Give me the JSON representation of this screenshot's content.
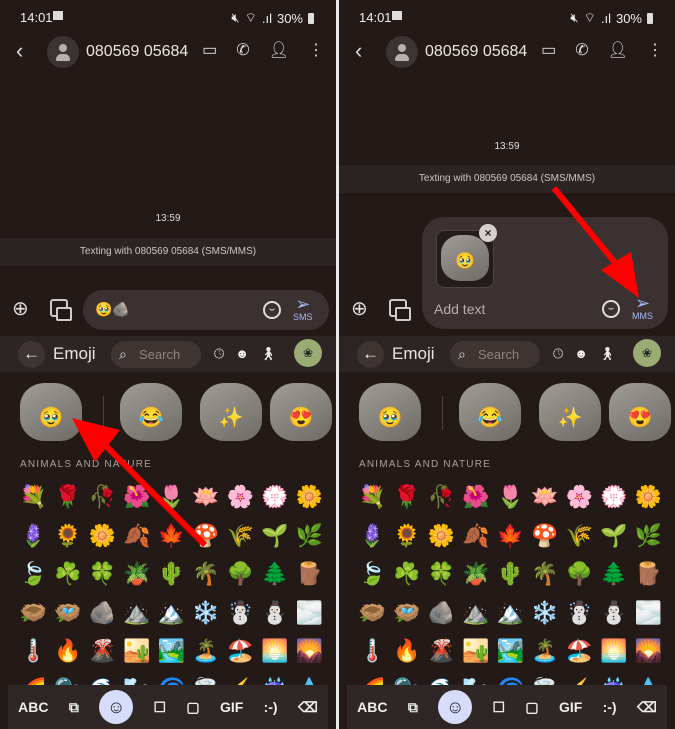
{
  "panels": [
    {
      "status": {
        "time": "14:01",
        "battery": "30%"
      },
      "header": {
        "contact": "080569 05684"
      },
      "conversation": {
        "timestamp": "13:59",
        "banner": "Texting with 080569 05684 (SMS/MMS)"
      },
      "compose": {
        "content_emojis": "🥹🪨",
        "send_label": "SMS"
      },
      "emoji_bar": {
        "title": "Emoji",
        "search_placeholder": "Search"
      },
      "section_label": "ANIMALS AND NATURE"
    },
    {
      "status": {
        "time": "14:01",
        "battery": "30%"
      },
      "header": {
        "contact": "080569 05684"
      },
      "conversation": {
        "timestamp": "13:59",
        "banner": "Texting with 080569 05684 (SMS/MMS)"
      },
      "compose": {
        "placeholder": "Add text",
        "send_label": "MMS"
      },
      "emoji_bar": {
        "title": "Emoji",
        "search_placeholder": "Search"
      },
      "section_label": "ANIMALS AND NATURE"
    }
  ],
  "stickers": [
    {
      "name": "rock-pleading",
      "face": "🥹"
    },
    {
      "name": "rock-laughing-tears",
      "face": "😂"
    },
    {
      "name": "rock-sparkles",
      "face": "✨"
    },
    {
      "name": "rock-heart-eyes",
      "face": "😍"
    }
  ],
  "emoji_grid": [
    "💐",
    "🌹",
    "🥀",
    "🌺",
    "🌷",
    "🪷",
    "🌸",
    "💮",
    "🌼",
    "🪻",
    "🌻",
    "🌼",
    "🍂",
    "🍁",
    "🍄",
    "🌾",
    "🌱",
    "🌿",
    "🍃",
    "☘️",
    "🍀",
    "🪴",
    "🌵",
    "🌴",
    "🌳",
    "🌲",
    "🪵",
    "🪹",
    "🪺",
    "🪨",
    "⛰️",
    "🏔️",
    "❄️",
    "☃️",
    "⛄",
    "🌫️",
    "🌡️",
    "🔥",
    "🌋",
    "🏜️",
    "🏞️",
    "🏝️",
    "🏖️",
    "🌅",
    "🌄",
    "🌈",
    "🫧",
    "🌊",
    "🌬️",
    "🌀",
    "🌪️",
    "⚡",
    "☔",
    "💧"
  ],
  "keyboard_bar": {
    "abc": "ABC",
    "gif": "GIF",
    "emoticon": ":-)"
  },
  "accent": {
    "send": "#a8b8f0",
    "selected_tab": "#d6dcfa",
    "active_category": "#9aab74",
    "annotation_arrow": "#ff0000"
  }
}
